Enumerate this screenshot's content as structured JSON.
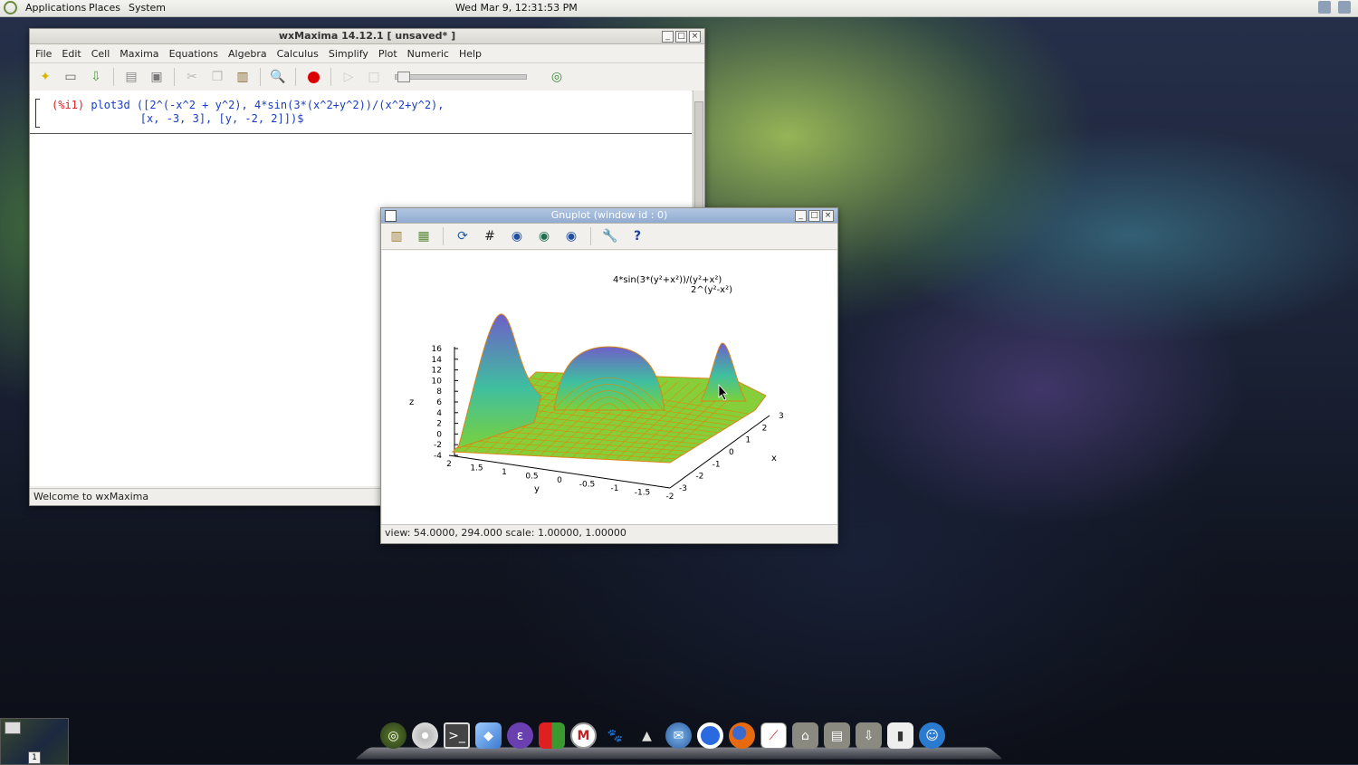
{
  "top_panel": {
    "menus": [
      "Applications",
      "Places",
      "System"
    ],
    "clock": "Wed Mar  9, 12:31:53 PM"
  },
  "wxmaxima": {
    "title": "wxMaxima 14.12.1 [ unsaved* ]",
    "menu": [
      "File",
      "Edit",
      "Cell",
      "Maxima",
      "Equations",
      "Algebra",
      "Calculus",
      "Simplify",
      "Plot",
      "Numeric",
      "Help"
    ],
    "input_label": "(%i1)",
    "input_line1": "plot3d ([2^(-x^2 + y^2), 4*sin(3*(x^2+y^2))/(x^2+y^2),",
    "input_line2": "        [x, -3, 3], [y, -2, 2]])$",
    "status": "Welcome to wxMaxima"
  },
  "gnuplot": {
    "title": "Gnuplot (window id : 0)",
    "status": "view: 54.0000,  294.000   scale: 1.00000,  1.00000",
    "key_line1": "4*sin(3*(y²+x²))/(y²+x²)",
    "key_line2": "2^(y²-x²)",
    "z_label": "z",
    "y_label": "y",
    "x_label": "x"
  },
  "chart_data": {
    "type": "surface",
    "zlabel": "z",
    "xlabel": "x",
    "ylabel": "y",
    "z_ticks": [
      "16",
      "14",
      "12",
      "10",
      "8",
      "6",
      "4",
      "2",
      "0",
      "-2",
      "-4"
    ],
    "y_ticks": [
      "2",
      "1.5",
      "1",
      "0.5",
      "0",
      "-0.5",
      "-1",
      "-1.5",
      "-2"
    ],
    "x_ticks": [
      "3",
      "2",
      "1",
      "0",
      "-1",
      "-2",
      "-3"
    ],
    "zlim": [
      -4,
      16
    ],
    "xlim": [
      -3,
      3
    ],
    "ylim": [
      -2,
      2
    ],
    "view": [
      54,
      294
    ],
    "series": [
      {
        "name": "4*sin(3*(y^2+x^2))/(y^2+x^2)"
      },
      {
        "name": "2^(y^2-x^2)"
      }
    ],
    "colors": {
      "surface_low": "#7ad13a",
      "surface_high": "#6f5fc8",
      "mesh": "#e08a00"
    }
  },
  "dock": {
    "workspace_number": "1",
    "icons": [
      "menu-icon",
      "disc-icon",
      "terminal-icon",
      "box-icon",
      "emacs-icon",
      "office-icon",
      "maxima-icon",
      "gimp-icon",
      "inkscape-icon",
      "thunderbird-icon",
      "chrome-icon",
      "firefox-icon",
      "chart-icon",
      "home-folder-icon",
      "documents-folder-icon",
      "downloads-folder-icon",
      "usb-drive-icon",
      "accessibility-icon"
    ]
  }
}
